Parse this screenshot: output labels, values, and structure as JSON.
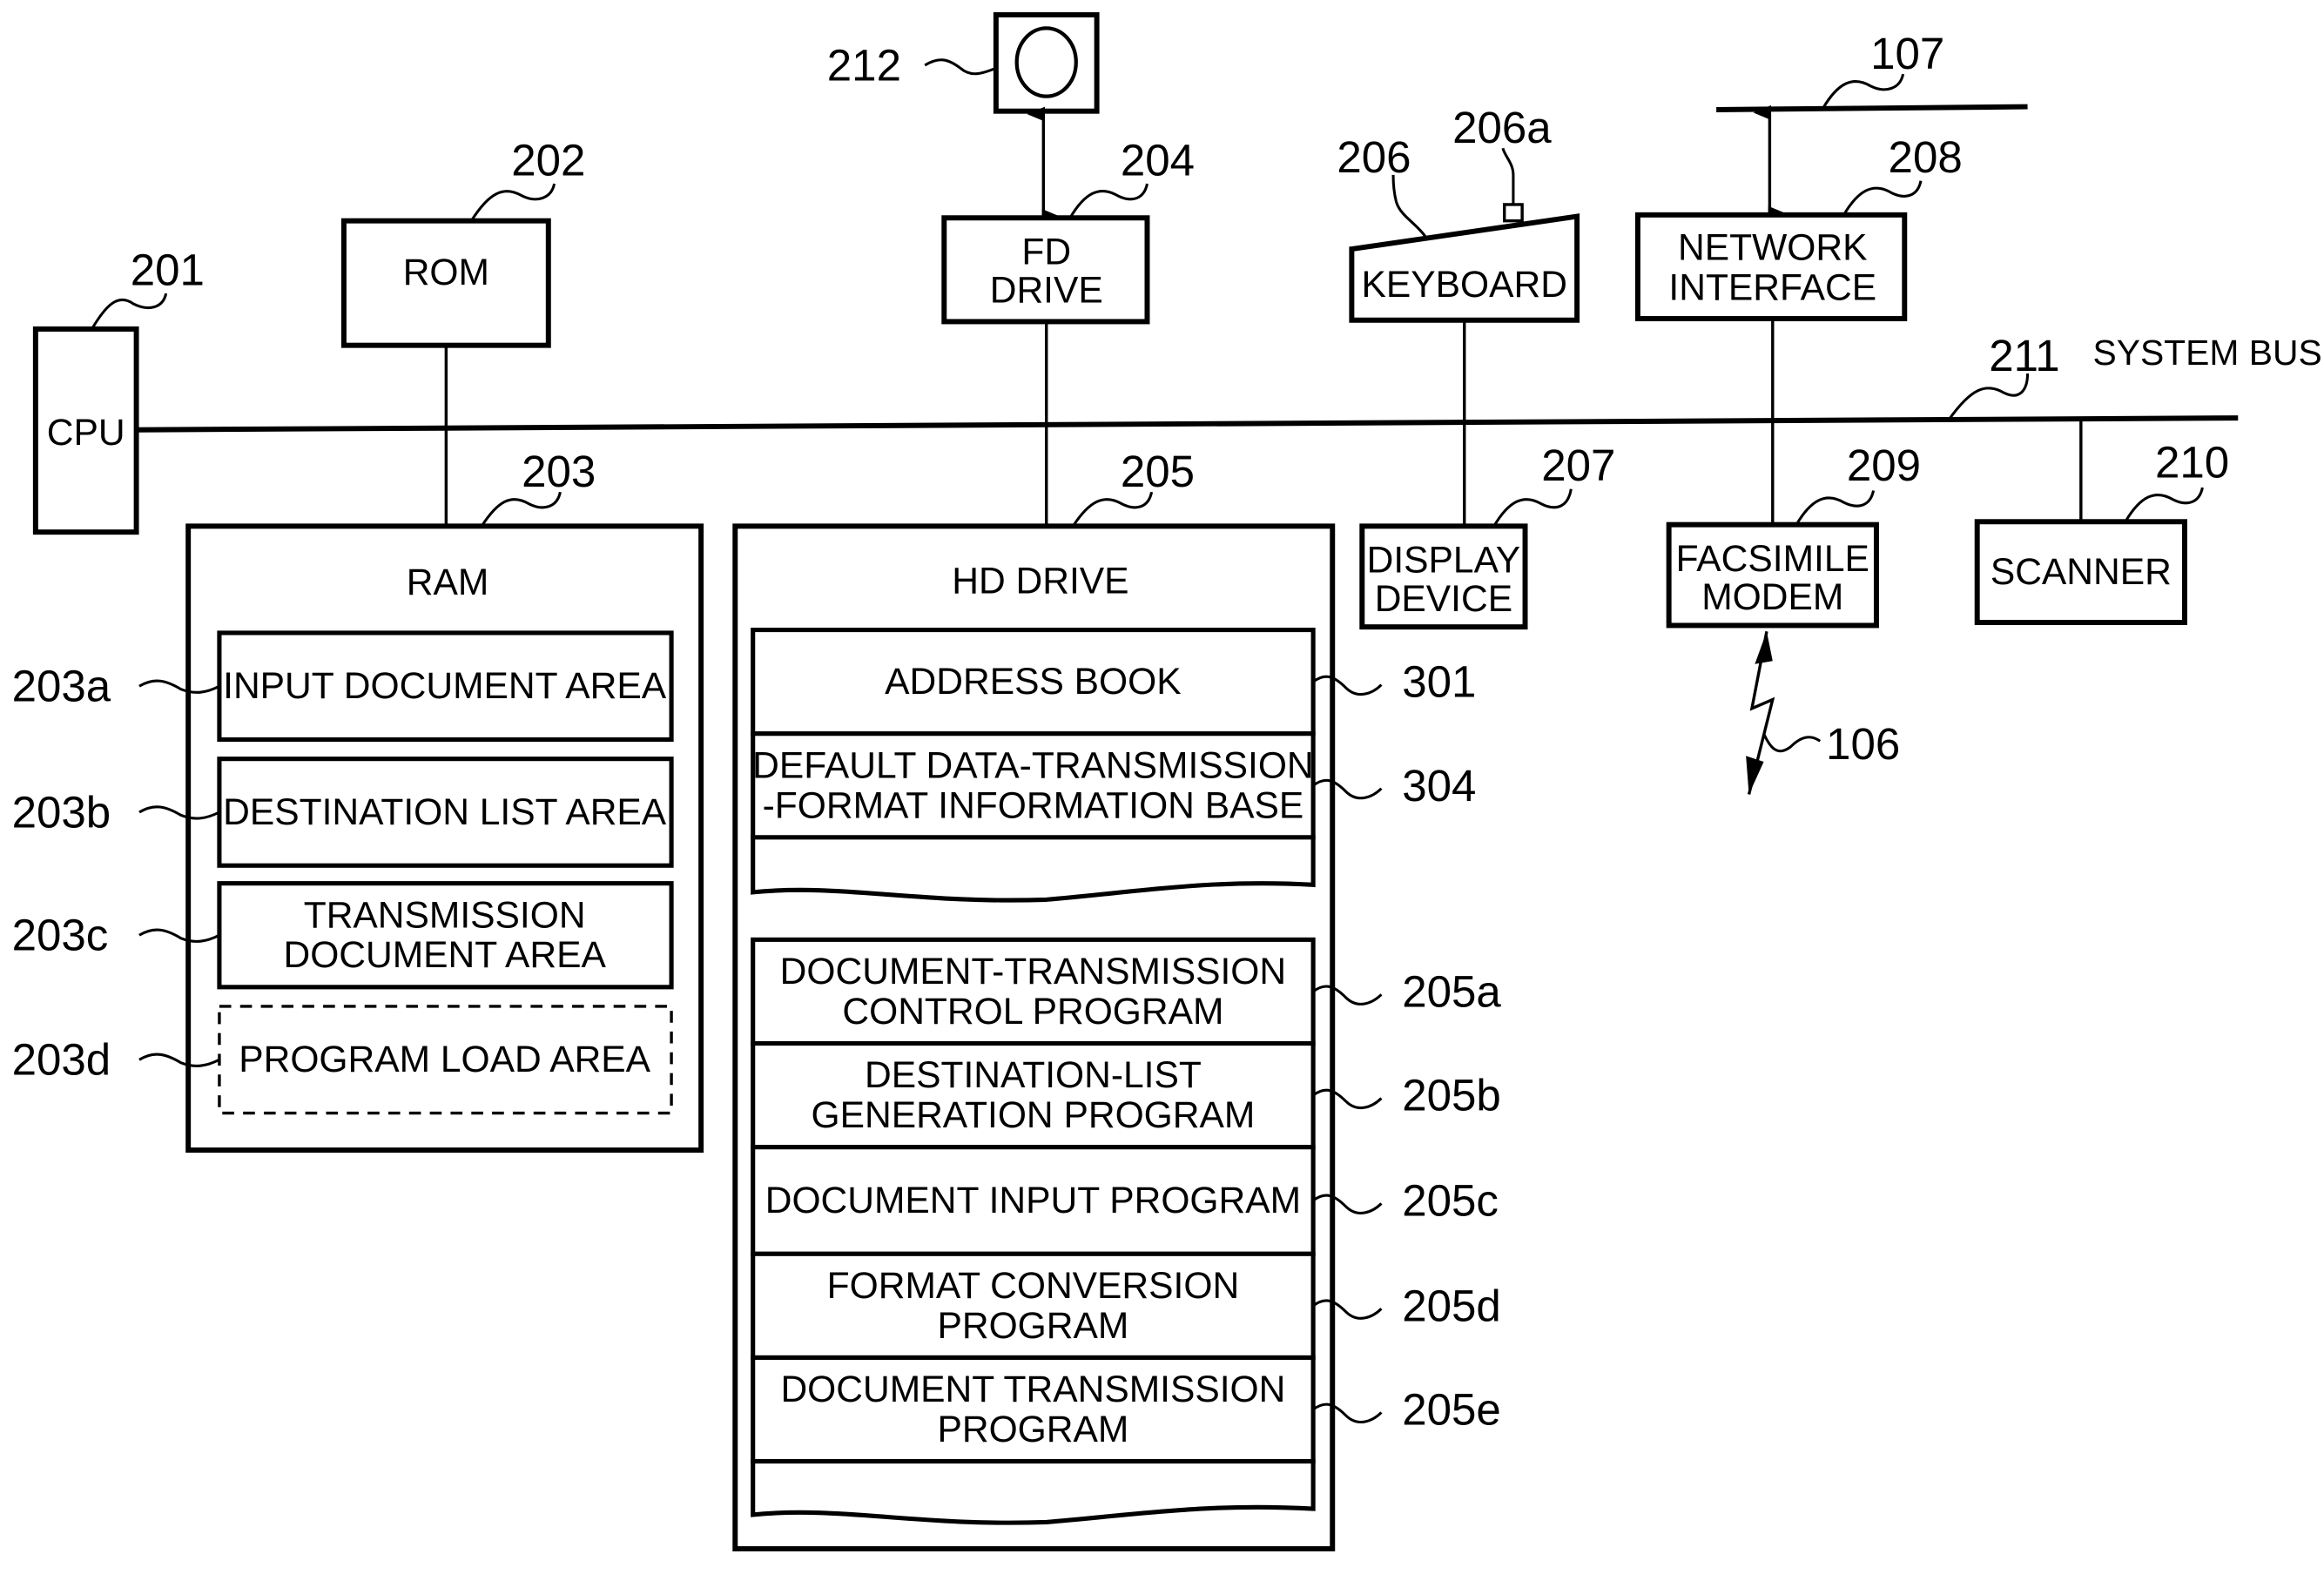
{
  "figure": {
    "system_bus": {
      "ref": "211",
      "label": "SYSTEM BUS"
    },
    "components": {
      "cpu": {
        "ref": "201",
        "label": "CPU"
      },
      "rom": {
        "ref": "202",
        "label": "ROM"
      },
      "ram": {
        "ref": "203",
        "label": "RAM"
      },
      "fd_drive": {
        "ref": "204",
        "label_lines": [
          "FD",
          "DRIVE"
        ]
      },
      "hd_drive": {
        "ref": "205",
        "label": "HD DRIVE"
      },
      "keyboard": {
        "ref": "206",
        "label": "KEYBOARD",
        "key_ref": "206a"
      },
      "display_device": {
        "ref": "207",
        "label_lines": [
          "DISPLAY",
          "DEVICE"
        ]
      },
      "network_interface": {
        "ref": "208",
        "label_lines": [
          "NETWORK",
          "INTERFACE"
        ]
      },
      "facsimile_modem": {
        "ref": "209",
        "label_lines": [
          "FACSIMILE",
          "MODEM"
        ]
      },
      "scanner": {
        "ref": "210",
        "label": "SCANNER"
      },
      "floppy_disk": {
        "ref": "212"
      },
      "network": {
        "ref": "107"
      },
      "phone_line": {
        "ref": "106"
      }
    },
    "ram_areas": [
      {
        "ref": "203a",
        "lines": [
          "INPUT DOCUMENT AREA"
        ]
      },
      {
        "ref": "203b",
        "lines": [
          "DESTINATION LIST AREA"
        ]
      },
      {
        "ref": "203c",
        "lines": [
          "TRANSMISSION",
          "DOCUMENT AREA"
        ]
      },
      {
        "ref": "203d",
        "lines": [
          "PROGRAM LOAD AREA"
        ]
      }
    ],
    "hd_data": [
      {
        "ref": "301",
        "lines": [
          "ADDRESS BOOK"
        ]
      },
      {
        "ref": "304",
        "lines": [
          "DEFAULT DATA-TRANSMISSION",
          "-FORMAT INFORMATION BASE"
        ]
      }
    ],
    "hd_programs": [
      {
        "ref": "205a",
        "lines": [
          "DOCUMENT-TRANSMISSION",
          "CONTROL PROGRAM"
        ]
      },
      {
        "ref": "205b",
        "lines": [
          "DESTINATION-LIST",
          "GENERATION PROGRAM"
        ]
      },
      {
        "ref": "205c",
        "lines": [
          "DOCUMENT INPUT PROGRAM"
        ]
      },
      {
        "ref": "205d",
        "lines": [
          "FORMAT CONVERSION",
          "PROGRAM"
        ]
      },
      {
        "ref": "205e",
        "lines": [
          "DOCUMENT TRANSMISSION",
          "PROGRAM"
        ]
      }
    ]
  }
}
